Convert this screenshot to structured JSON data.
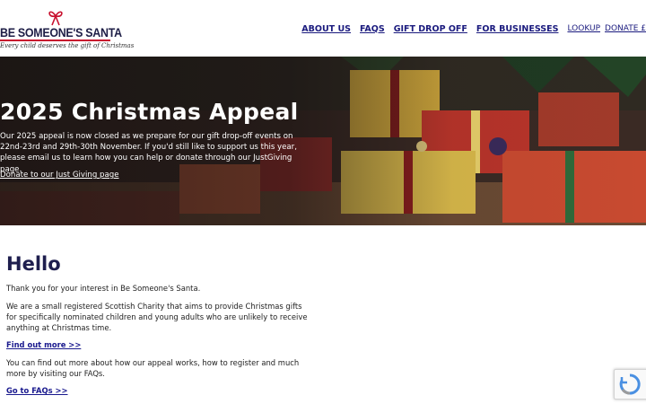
{
  "header": {
    "logo_title": "BE SOMEONE'S SANTA",
    "logo_tagline": "Every child deserves the gift of Christmas",
    "nav": [
      {
        "label": "ABOUT US"
      },
      {
        "label": "FAQS"
      },
      {
        "label": "GIFT DROP OFF"
      },
      {
        "label": "FOR BUSINESSES"
      }
    ],
    "nav_secondary": [
      {
        "label": "LOOKUP"
      },
      {
        "label": "DONATE £"
      }
    ]
  },
  "hero": {
    "title": "2025 Christmas Appeal",
    "text": "Our 2025 appeal is now closed as we prepare for our gift drop-off events on 22nd-23rd and 29th-30th November. If you'd still like to support us this year, please email us to learn how you can help or donate through our JustGiving page.",
    "link": "Donate to our Just Giving page"
  },
  "main": {
    "heading": "Hello",
    "p1": "Thank you for your interest in Be Someone's Santa.",
    "p2": "We are a small registered Scottish Charity that aims to provide Christmas gifts for specifically nominated children and young adults who are unlikely to receive anything at Christmas time.",
    "link1": "Find out more >>",
    "p3": "You can find out more about how our appeal works, how to register and much more by visiting our FAQs.",
    "link2": "Go to FAQs >>"
  },
  "colors": {
    "brand_navy": "#1e1e4e",
    "brand_red": "#c8102e",
    "link_blue": "#1a1a8e"
  },
  "icons": {
    "logo_bow": "ribbon-bow-icon",
    "captcha": "recaptcha-icon"
  }
}
